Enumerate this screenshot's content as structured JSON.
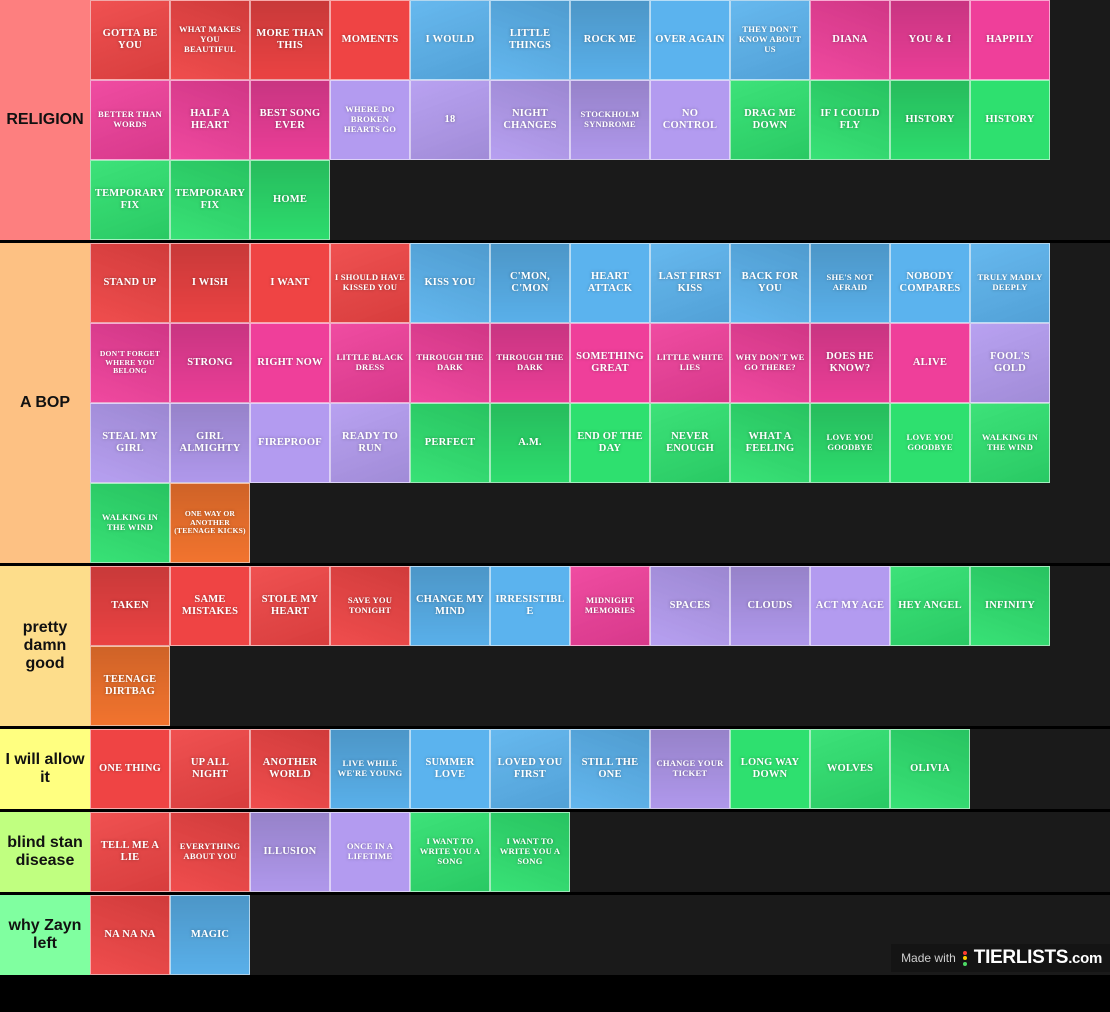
{
  "watermark": {
    "made_with": "Made with",
    "brand": "TIERLISTS",
    "domain": ".com",
    "dot_colors": [
      "#ff3b30",
      "#ffcc00",
      "#4cd964"
    ]
  },
  "palette": {
    "background": "#000000",
    "tier_body": "#1a1a1a",
    "red": "#ef4444",
    "blue": "#5bb3ee",
    "magenta": "#ef3f9a",
    "purple": "#b39bf0",
    "green": "#2ee06f",
    "orange": "#f7762f"
  },
  "tiers": [
    {
      "label": "RELIGION",
      "label_color": "#fd7f7f",
      "tiles": [
        {
          "label": "GOTTA BE YOU",
          "color": "red"
        },
        {
          "label": "WHAT MAKES YOU BEAUTIFUL",
          "color": "red"
        },
        {
          "label": "MORE THAN THIS",
          "color": "red"
        },
        {
          "label": "MOMENTS",
          "color": "red"
        },
        {
          "label": "I WOULD",
          "color": "blue"
        },
        {
          "label": "LITTLE THINGS",
          "color": "blue"
        },
        {
          "label": "ROCK ME",
          "color": "blue"
        },
        {
          "label": "OVER AGAIN",
          "color": "blue"
        },
        {
          "label": "THEY DON'T KNOW ABOUT US",
          "color": "blue"
        },
        {
          "label": "DIANA",
          "color": "magenta"
        },
        {
          "label": "YOU & I",
          "color": "magenta"
        },
        {
          "label": "HAPPILY",
          "color": "magenta"
        },
        {
          "label": "BETTER THAN WORDS",
          "color": "magenta"
        },
        {
          "label": "HALF A HEART",
          "color": "magenta"
        },
        {
          "label": "BEST SONG EVER",
          "color": "magenta"
        },
        {
          "label": "WHERE DO BROKEN HEARTS GO",
          "color": "purple"
        },
        {
          "label": "18",
          "color": "purple"
        },
        {
          "label": "NIGHT CHANGES",
          "color": "purple"
        },
        {
          "label": "STOCKHOLM SYNDROME",
          "color": "purple"
        },
        {
          "label": "NO CONTROL",
          "color": "purple"
        },
        {
          "label": "DRAG ME DOWN",
          "color": "green"
        },
        {
          "label": "IF I COULD FLY",
          "color": "green"
        },
        {
          "label": "HISTORY",
          "color": "green"
        },
        {
          "label": "HISTORY",
          "color": "green"
        },
        {
          "label": "TEMPORARY FIX",
          "color": "green"
        },
        {
          "label": "TEMPORARY FIX",
          "color": "green"
        },
        {
          "label": "HOME",
          "color": "green"
        }
      ]
    },
    {
      "label": "A BOP",
      "label_color": "#fdc183",
      "tiles": [
        {
          "label": "STAND UP",
          "color": "red"
        },
        {
          "label": "I WISH",
          "color": "red"
        },
        {
          "label": "I WANT",
          "color": "red"
        },
        {
          "label": "I SHOULD HAVE KISSED YOU",
          "color": "red"
        },
        {
          "label": "KISS YOU",
          "color": "blue"
        },
        {
          "label": "C'MON, C'MON",
          "color": "blue"
        },
        {
          "label": "HEART ATTACK",
          "color": "blue"
        },
        {
          "label": "LAST FIRST KISS",
          "color": "blue"
        },
        {
          "label": "BACK FOR YOU",
          "color": "blue"
        },
        {
          "label": "SHE'S NOT AFRAID",
          "color": "blue"
        },
        {
          "label": "NOBODY COMPARES",
          "color": "blue"
        },
        {
          "label": "TRULY MADLY DEEPLY",
          "color": "blue"
        },
        {
          "label": "DON'T FORGET WHERE YOU BELONG",
          "color": "magenta"
        },
        {
          "label": "STRONG",
          "color": "magenta"
        },
        {
          "label": "RIGHT NOW",
          "color": "magenta"
        },
        {
          "label": "LITTLE BLACK DRESS",
          "color": "magenta"
        },
        {
          "label": "THROUGH THE DARK",
          "color": "magenta"
        },
        {
          "label": "THROUGH THE DARK",
          "color": "magenta"
        },
        {
          "label": "SOMETHING GREAT",
          "color": "magenta"
        },
        {
          "label": "LITTLE WHITE LIES",
          "color": "magenta"
        },
        {
          "label": "WHY DON'T WE GO THERE?",
          "color": "magenta"
        },
        {
          "label": "DOES HE KNOW?",
          "color": "magenta"
        },
        {
          "label": "ALIVE",
          "color": "magenta"
        },
        {
          "label": "FOOL'S GOLD",
          "color": "purple"
        },
        {
          "label": "STEAL MY GIRL",
          "color": "purple"
        },
        {
          "label": "GIRL ALMIGHTY",
          "color": "purple"
        },
        {
          "label": "FIREPROOF",
          "color": "purple"
        },
        {
          "label": "READY TO RUN",
          "color": "purple"
        },
        {
          "label": "PERFECT",
          "color": "green"
        },
        {
          "label": "A.M.",
          "color": "green"
        },
        {
          "label": "END OF THE DAY",
          "color": "green"
        },
        {
          "label": "NEVER ENOUGH",
          "color": "green"
        },
        {
          "label": "WHAT A FEELING",
          "color": "green"
        },
        {
          "label": "LOVE YOU GOODBYE",
          "color": "green"
        },
        {
          "label": "LOVE YOU GOODBYE",
          "color": "green"
        },
        {
          "label": "WALKING IN THE WIND",
          "color": "green"
        },
        {
          "label": "WALKING IN THE WIND",
          "color": "green"
        },
        {
          "label": "ONE WAY OR ANOTHER (TEENAGE KICKS)",
          "color": "orange"
        }
      ]
    },
    {
      "label": "pretty damn good",
      "label_color": "#fddd8b",
      "tiles": [
        {
          "label": "TAKEN",
          "color": "red"
        },
        {
          "label": "SAME MISTAKES",
          "color": "red"
        },
        {
          "label": "STOLE MY HEART",
          "color": "red"
        },
        {
          "label": "SAVE YOU TONIGHT",
          "color": "red"
        },
        {
          "label": "CHANGE MY MIND",
          "color": "blue"
        },
        {
          "label": "IRRESISTIBLE",
          "color": "blue"
        },
        {
          "label": "MIDNIGHT MEMORIES",
          "color": "magenta"
        },
        {
          "label": "SPACES",
          "color": "purple"
        },
        {
          "label": "CLOUDS",
          "color": "purple"
        },
        {
          "label": "ACT MY AGE",
          "color": "purple"
        },
        {
          "label": "HEY ANGEL",
          "color": "green"
        },
        {
          "label": "INFINITY",
          "color": "green"
        },
        {
          "label": "TEENAGE DIRTBAG",
          "color": "orange"
        }
      ]
    },
    {
      "label": "I will allow it",
      "label_color": "#ffff80",
      "tiles": [
        {
          "label": "ONE THING",
          "color": "red"
        },
        {
          "label": "UP ALL NIGHT",
          "color": "red"
        },
        {
          "label": "ANOTHER WORLD",
          "color": "red"
        },
        {
          "label": "LIVE WHILE WE'RE YOUNG",
          "color": "blue"
        },
        {
          "label": "SUMMER LOVE",
          "color": "blue"
        },
        {
          "label": "LOVED YOU FIRST",
          "color": "blue"
        },
        {
          "label": "STILL THE ONE",
          "color": "blue"
        },
        {
          "label": "CHANGE YOUR TICKET",
          "color": "purple"
        },
        {
          "label": "LONG WAY DOWN",
          "color": "green"
        },
        {
          "label": "WOLVES",
          "color": "green"
        },
        {
          "label": "OLIVIA",
          "color": "green"
        }
      ]
    },
    {
      "label": "blind stan disease",
      "label_color": "#c0ff80",
      "tiles": [
        {
          "label": "TELL ME A LIE",
          "color": "red"
        },
        {
          "label": "EVERYTHING ABOUT YOU",
          "color": "red"
        },
        {
          "label": "ILLUSION",
          "color": "purple"
        },
        {
          "label": "ONCE IN A LIFETIME",
          "color": "purple"
        },
        {
          "label": "I WANT TO WRITE YOU A SONG",
          "color": "green"
        },
        {
          "label": "I WANT TO WRITE YOU A SONG",
          "color": "green"
        }
      ]
    },
    {
      "label": "why Zayn left",
      "label_color": "#80ffa0",
      "tiles": [
        {
          "label": "NA NA NA",
          "color": "red"
        },
        {
          "label": "MAGIC",
          "color": "blue"
        }
      ]
    }
  ]
}
